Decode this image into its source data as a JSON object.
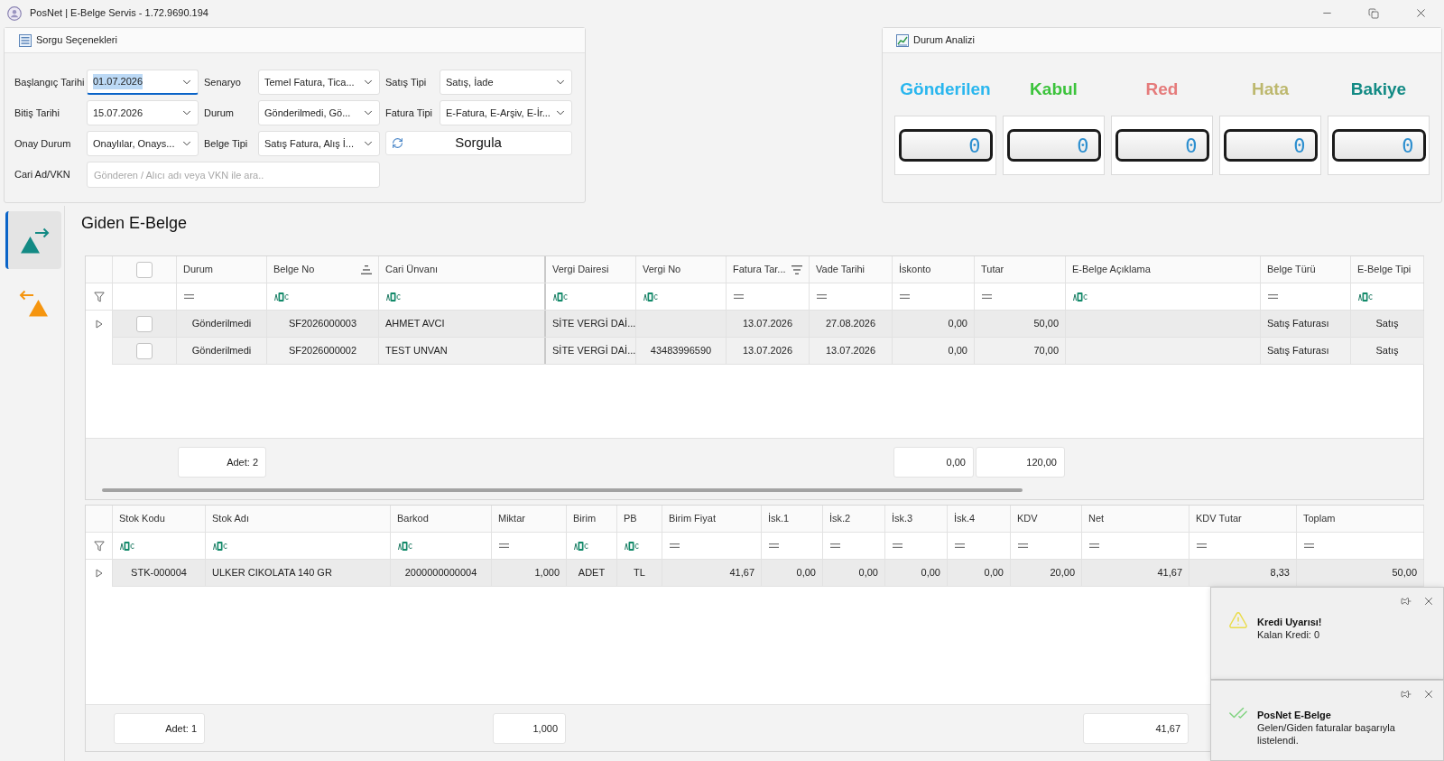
{
  "window": {
    "title": "PosNet | E-Belge Servis - 1.72.9690.194"
  },
  "query_panel": {
    "title": "Sorgu Seçenekleri",
    "fields": [
      {
        "label": "Başlangıç Tarihi",
        "value": "01.07.2026",
        "focused": true
      },
      {
        "label": "Senaryo",
        "value": "Temel Fatura, Tica...",
        "focused": false
      },
      {
        "label": "Satış Tipi",
        "value": "Satış, İade",
        "focused": false
      },
      {
        "label": "Bitiş Tarihi",
        "value": "15.07.2026",
        "focused": false
      },
      {
        "label": "Durum",
        "value": "Gönderilmedi, Gö...",
        "focused": false
      },
      {
        "label": "Fatura Tipi",
        "value": "E-Fatura, E-Arşiv, E-İr...",
        "focused": false
      },
      {
        "label": "Onay Durum",
        "value": "Onaylılar, Onays...",
        "focused": false
      },
      {
        "label": "Belge Tipi",
        "value": "Satış Fatura, Alış İ...",
        "focused": false
      }
    ],
    "query_button": "Sorgula",
    "search": {
      "label": "Cari Ad/VKN",
      "placeholder": "Gönderen / Alıcı adı veya VKN ile ara.."
    }
  },
  "status_panel": {
    "title": "Durum Analizi",
    "counters": [
      {
        "label": "Gönderilen",
        "color": "#29b6ee",
        "value": "0"
      },
      {
        "label": "Kabul",
        "color": "#3cc33c",
        "value": "0"
      },
      {
        "label": "Red",
        "color": "#e57b7b",
        "value": "0"
      },
      {
        "label": "Hata",
        "color": "#bdb86e",
        "value": "0"
      },
      {
        "label": "Bakiye",
        "color": "#128a84",
        "value": "0"
      }
    ]
  },
  "nav": [
    {
      "kind": "outgoing",
      "selected": true
    },
    {
      "kind": "incoming",
      "selected": false
    }
  ],
  "section_title": "Giden E-Belge",
  "invoice_grid": {
    "select_all_checked": false,
    "columns": [
      {
        "label": "Durum",
        "filter": {
          "kind": "equals"
        },
        "summary": "Adet: 2"
      },
      {
        "label": "Belge No",
        "sort": {
          "kind": "ascending"
        },
        "filter": {
          "kind": "text"
        }
      },
      {
        "label": "Cari Ünvanı",
        "filter": {
          "kind": "text"
        }
      },
      {
        "label": "Vergi Dairesi",
        "filter": {
          "kind": "text"
        }
      },
      {
        "label": "Vergi No",
        "filter": {
          "kind": "text"
        }
      },
      {
        "label": "Fatura Tar...",
        "sort": {
          "kind": "descending"
        },
        "filter": {
          "kind": "equals"
        }
      },
      {
        "label": "Vade Tarihi",
        "filter": {
          "kind": "equals"
        }
      },
      {
        "label": "İskonto",
        "filter": {
          "kind": "equals"
        },
        "summary": "0,00"
      },
      {
        "label": "Tutar",
        "filter": {
          "kind": "equals"
        },
        "summary": "120,00"
      },
      {
        "label": "E-Belge Açıklama",
        "filter": {
          "kind": "text"
        }
      },
      {
        "label": "Belge Türü",
        "filter": {
          "kind": "equals"
        }
      },
      {
        "label": "E-Belge Tipi",
        "filter": {
          "kind": "text"
        }
      }
    ],
    "rows": [
      {
        "focused": true,
        "checked": false,
        "cells": [
          "Gönderilmedi",
          "SF2026000003",
          "AHMET AVCI",
          "SİTE VERGİ DAİ...",
          null,
          "13.07.2026",
          "27.08.2026",
          "0,00",
          "50,00",
          null,
          "Satış Faturası",
          "Satış"
        ]
      },
      {
        "focused": false,
        "checked": false,
        "cells": [
          "Gönderilmedi",
          "SF2026000002",
          "TEST UNVAN",
          "SİTE VERGİ DAİ...",
          "43483996590",
          "13.07.2026",
          "13.07.2026",
          "0,00",
          "70,00",
          null,
          "Satış Faturası",
          "Satış"
        ]
      }
    ]
  },
  "line_grid": {
    "columns": [
      {
        "label": "Stok Kodu",
        "filter": {
          "kind": "text"
        },
        "summary": "Adet: 1"
      },
      {
        "label": "Stok Adı",
        "filter": {
          "kind": "text"
        }
      },
      {
        "label": "Barkod",
        "filter": {
          "kind": "text"
        }
      },
      {
        "label": "Miktar",
        "filter": {
          "kind": "equals"
        },
        "summary": "1,000"
      },
      {
        "label": "Birim",
        "filter": {
          "kind": "text"
        }
      },
      {
        "label": "PB",
        "filter": {
          "kind": "text"
        }
      },
      {
        "label": "Birim Fiyat",
        "filter": {
          "kind": "equals"
        }
      },
      {
        "label": "İsk.1",
        "filter": {
          "kind": "equals"
        }
      },
      {
        "label": "İsk.2",
        "filter": {
          "kind": "equals"
        }
      },
      {
        "label": "İsk.3",
        "filter": {
          "kind": "equals"
        }
      },
      {
        "label": "İsk.4",
        "filter": {
          "kind": "equals"
        }
      },
      {
        "label": "KDV",
        "filter": {
          "kind": "equals"
        }
      },
      {
        "label": "Net",
        "filter": {
          "kind": "equals"
        },
        "summary": "41,67"
      },
      {
        "label": "KDV Tutar",
        "filter": {
          "kind": "equals"
        }
      },
      {
        "label": "Toplam",
        "filter": {
          "kind": "equals"
        }
      }
    ],
    "rows": [
      {
        "focused": true,
        "cells": [
          "STK-000004",
          "ULKER CIKOLATA 140 GR",
          "2000000000004",
          "1,000",
          "ADET",
          "TL",
          "41,67",
          "0,00",
          "0,00",
          "0,00",
          "0,00",
          "20,00",
          "41,67",
          "8,33",
          "50,00"
        ]
      }
    ]
  },
  "notifications": [
    {
      "kind": "warning",
      "title": "Kredi Uyarısı!",
      "message": "Kalan Kredi: 0"
    },
    {
      "kind": "success",
      "title": "PosNet E-Belge",
      "message": "Gelen/Giden faturalar başarıyla listelendi."
    }
  ]
}
